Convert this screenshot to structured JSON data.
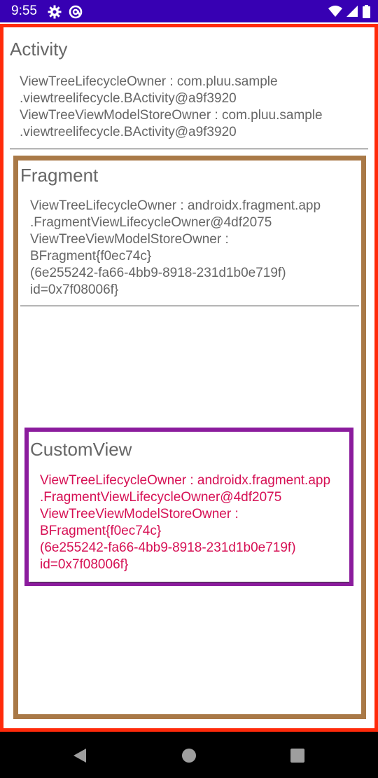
{
  "status_bar": {
    "time": "9:55",
    "left_icons": [
      "gear-icon",
      "at-sign-icon"
    ],
    "right_icons": [
      "wifi-icon",
      "signal-icon",
      "battery-icon"
    ]
  },
  "activity": {
    "title": "Activity",
    "lines": [
      "ViewTreeLifecycleOwner : com.pluu.sample",
      ".viewtreelifecycle.BActivity@a9f3920",
      "ViewTreeViewModelStoreOwner : com.pluu.sample",
      ".viewtreelifecycle.BActivity@a9f3920"
    ]
  },
  "fragment": {
    "title": "Fragment",
    "lines": [
      "ViewTreeLifecycleOwner : androidx.fragment.app",
      ".FragmentViewLifecycleOwner@4df2075",
      "ViewTreeViewModelStoreOwner :",
      "BFragment{f0ec74c}",
      "(6e255242-fa66-4bb9-8918-231d1b0e719f)",
      "id=0x7f08006f}"
    ]
  },
  "custom_view": {
    "title": "CustomView",
    "lines": [
      "ViewTreeLifecycleOwner : androidx.fragment.app",
      ".FragmentViewLifecycleOwner@4df2075",
      "ViewTreeViewModelStoreOwner :",
      "BFragment{f0ec74c}",
      "(6e255242-fa66-4bb9-8918-231d1b0e719f)",
      "id=0x7f08006f}"
    ]
  },
  "navigation": {
    "buttons": [
      "back-icon",
      "home-icon",
      "recents-icon"
    ]
  },
  "colors": {
    "status_bar": "#3700b3",
    "activity_border": "#ff2a0a",
    "fragment_border": "#a97947",
    "custom_view_border": "#8b1c9d",
    "custom_view_text": "#d61054",
    "body_text": "#666666"
  }
}
